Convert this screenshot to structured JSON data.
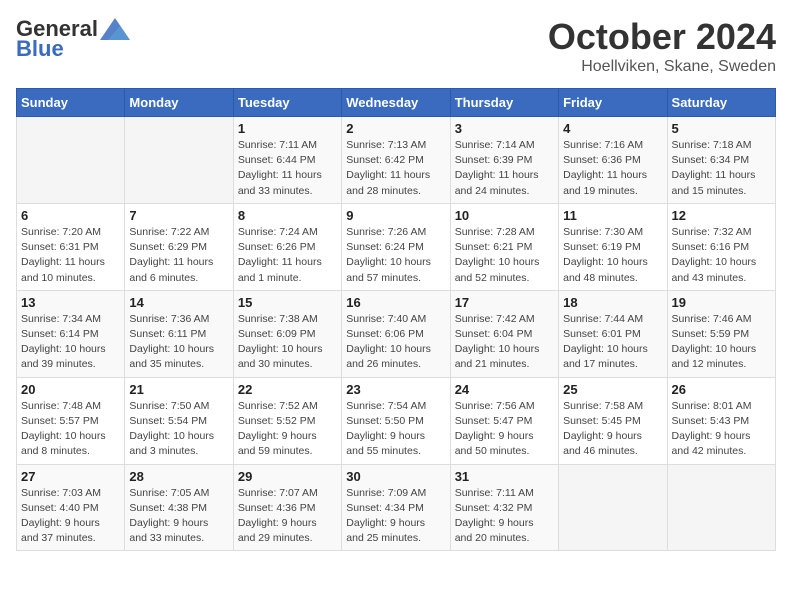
{
  "header": {
    "logo_general": "General",
    "logo_blue": "Blue",
    "month": "October 2024",
    "location": "Hoellviken, Skane, Sweden"
  },
  "days_of_week": [
    "Sunday",
    "Monday",
    "Tuesday",
    "Wednesday",
    "Thursday",
    "Friday",
    "Saturday"
  ],
  "weeks": [
    [
      {
        "day": "",
        "detail": ""
      },
      {
        "day": "",
        "detail": ""
      },
      {
        "day": "1",
        "detail": "Sunrise: 7:11 AM\nSunset: 6:44 PM\nDaylight: 11 hours\nand 33 minutes."
      },
      {
        "day": "2",
        "detail": "Sunrise: 7:13 AM\nSunset: 6:42 PM\nDaylight: 11 hours\nand 28 minutes."
      },
      {
        "day": "3",
        "detail": "Sunrise: 7:14 AM\nSunset: 6:39 PM\nDaylight: 11 hours\nand 24 minutes."
      },
      {
        "day": "4",
        "detail": "Sunrise: 7:16 AM\nSunset: 6:36 PM\nDaylight: 11 hours\nand 19 minutes."
      },
      {
        "day": "5",
        "detail": "Sunrise: 7:18 AM\nSunset: 6:34 PM\nDaylight: 11 hours\nand 15 minutes."
      }
    ],
    [
      {
        "day": "6",
        "detail": "Sunrise: 7:20 AM\nSunset: 6:31 PM\nDaylight: 11 hours\nand 10 minutes."
      },
      {
        "day": "7",
        "detail": "Sunrise: 7:22 AM\nSunset: 6:29 PM\nDaylight: 11 hours\nand 6 minutes."
      },
      {
        "day": "8",
        "detail": "Sunrise: 7:24 AM\nSunset: 6:26 PM\nDaylight: 11 hours\nand 1 minute."
      },
      {
        "day": "9",
        "detail": "Sunrise: 7:26 AM\nSunset: 6:24 PM\nDaylight: 10 hours\nand 57 minutes."
      },
      {
        "day": "10",
        "detail": "Sunrise: 7:28 AM\nSunset: 6:21 PM\nDaylight: 10 hours\nand 52 minutes."
      },
      {
        "day": "11",
        "detail": "Sunrise: 7:30 AM\nSunset: 6:19 PM\nDaylight: 10 hours\nand 48 minutes."
      },
      {
        "day": "12",
        "detail": "Sunrise: 7:32 AM\nSunset: 6:16 PM\nDaylight: 10 hours\nand 43 minutes."
      }
    ],
    [
      {
        "day": "13",
        "detail": "Sunrise: 7:34 AM\nSunset: 6:14 PM\nDaylight: 10 hours\nand 39 minutes."
      },
      {
        "day": "14",
        "detail": "Sunrise: 7:36 AM\nSunset: 6:11 PM\nDaylight: 10 hours\nand 35 minutes."
      },
      {
        "day": "15",
        "detail": "Sunrise: 7:38 AM\nSunset: 6:09 PM\nDaylight: 10 hours\nand 30 minutes."
      },
      {
        "day": "16",
        "detail": "Sunrise: 7:40 AM\nSunset: 6:06 PM\nDaylight: 10 hours\nand 26 minutes."
      },
      {
        "day": "17",
        "detail": "Sunrise: 7:42 AM\nSunset: 6:04 PM\nDaylight: 10 hours\nand 21 minutes."
      },
      {
        "day": "18",
        "detail": "Sunrise: 7:44 AM\nSunset: 6:01 PM\nDaylight: 10 hours\nand 17 minutes."
      },
      {
        "day": "19",
        "detail": "Sunrise: 7:46 AM\nSunset: 5:59 PM\nDaylight: 10 hours\nand 12 minutes."
      }
    ],
    [
      {
        "day": "20",
        "detail": "Sunrise: 7:48 AM\nSunset: 5:57 PM\nDaylight: 10 hours\nand 8 minutes."
      },
      {
        "day": "21",
        "detail": "Sunrise: 7:50 AM\nSunset: 5:54 PM\nDaylight: 10 hours\nand 3 minutes."
      },
      {
        "day": "22",
        "detail": "Sunrise: 7:52 AM\nSunset: 5:52 PM\nDaylight: 9 hours\nand 59 minutes."
      },
      {
        "day": "23",
        "detail": "Sunrise: 7:54 AM\nSunset: 5:50 PM\nDaylight: 9 hours\nand 55 minutes."
      },
      {
        "day": "24",
        "detail": "Sunrise: 7:56 AM\nSunset: 5:47 PM\nDaylight: 9 hours\nand 50 minutes."
      },
      {
        "day": "25",
        "detail": "Sunrise: 7:58 AM\nSunset: 5:45 PM\nDaylight: 9 hours\nand 46 minutes."
      },
      {
        "day": "26",
        "detail": "Sunrise: 8:01 AM\nSunset: 5:43 PM\nDaylight: 9 hours\nand 42 minutes."
      }
    ],
    [
      {
        "day": "27",
        "detail": "Sunrise: 7:03 AM\nSunset: 4:40 PM\nDaylight: 9 hours\nand 37 minutes."
      },
      {
        "day": "28",
        "detail": "Sunrise: 7:05 AM\nSunset: 4:38 PM\nDaylight: 9 hours\nand 33 minutes."
      },
      {
        "day": "29",
        "detail": "Sunrise: 7:07 AM\nSunset: 4:36 PM\nDaylight: 9 hours\nand 29 minutes."
      },
      {
        "day": "30",
        "detail": "Sunrise: 7:09 AM\nSunset: 4:34 PM\nDaylight: 9 hours\nand 25 minutes."
      },
      {
        "day": "31",
        "detail": "Sunrise: 7:11 AM\nSunset: 4:32 PM\nDaylight: 9 hours\nand 20 minutes."
      },
      {
        "day": "",
        "detail": ""
      },
      {
        "day": "",
        "detail": ""
      }
    ]
  ]
}
